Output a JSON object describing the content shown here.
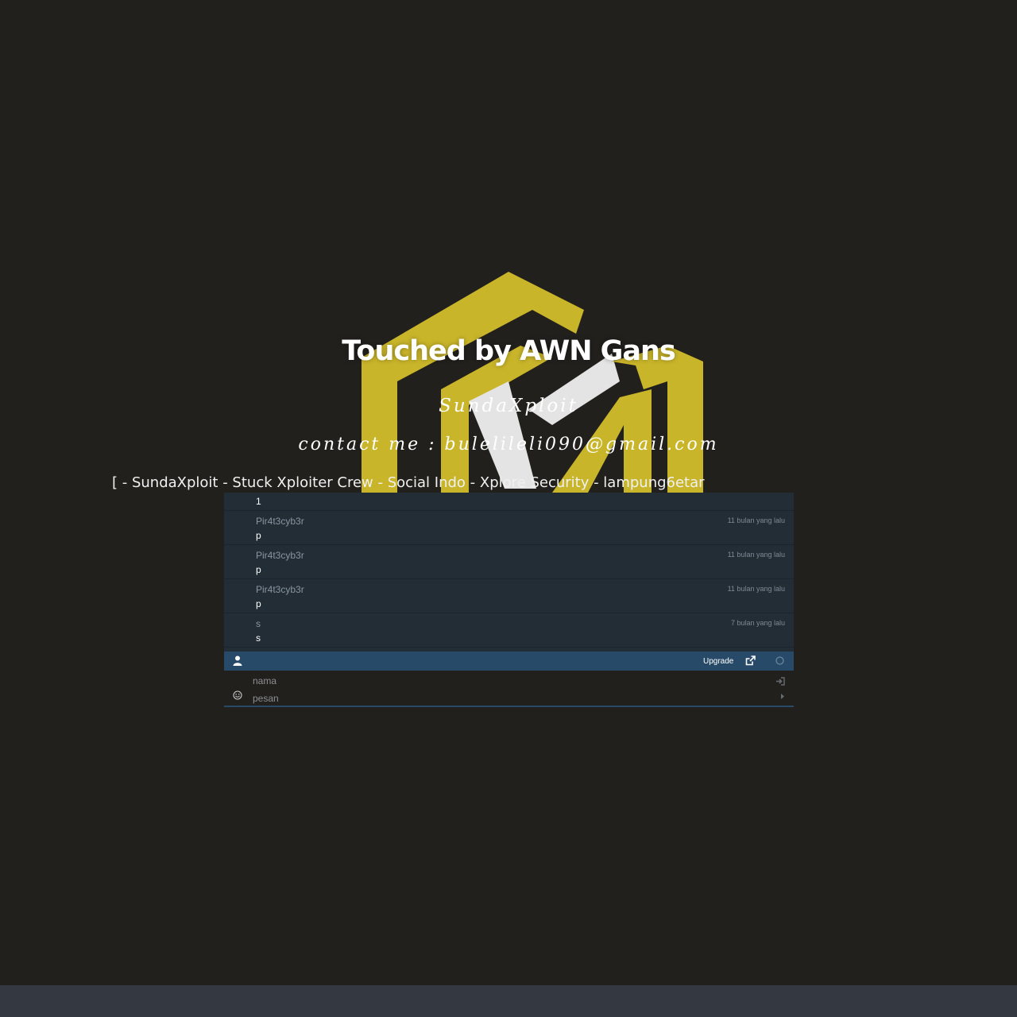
{
  "banner": {
    "title": "Touched by AWN Gans",
    "subtitle": "SundaXploit",
    "contact": "contact me : bulelileli090@gmail.com",
    "crews": "[ - SundaXploit - Stuck Xploiter Crew - Social Indo - Xplore Security - lampung6etar"
  },
  "chat": {
    "first_message": "1",
    "messages": [
      {
        "user": "Pir4t3cyb3r",
        "time": "11 bulan yang lalu",
        "text": "p"
      },
      {
        "user": "Pir4t3cyb3r",
        "time": "11 bulan yang lalu",
        "text": "p"
      },
      {
        "user": "Pir4t3cyb3r",
        "time": "11 bulan yang lalu",
        "text": "p"
      },
      {
        "user": "s",
        "time": "7 bulan yang lalu",
        "text": "s"
      }
    ],
    "toolbar": {
      "upgrade_label": "Upgrade"
    },
    "form": {
      "name_placeholder": "nama",
      "message_placeholder": "pesan"
    }
  },
  "colors": {
    "background": "#22201d",
    "logo_yellow": "#c9b52a",
    "logo_white": "#e4e4e4",
    "chat_panel": "#232d36",
    "chat_toolbar": "#274a68",
    "bottom_bar": "#343840"
  },
  "icons": {
    "toolbar_user": "user-icon",
    "toolbar_popout": "external-link-icon",
    "toolbar_status": "status-circle-icon",
    "form_name": "sign-in-icon",
    "form_emoji": "smiley-icon",
    "form_send": "send-arrow-icon"
  }
}
